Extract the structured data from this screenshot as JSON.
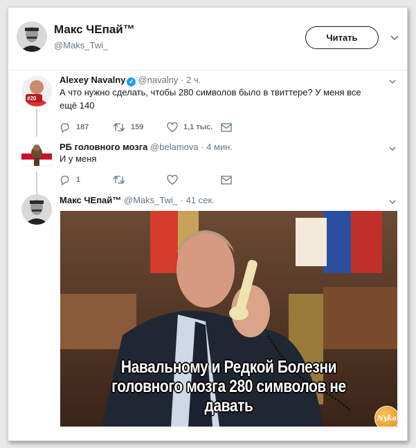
{
  "header": {
    "display_name": "Макс ЧЕпай™",
    "handle": "@Maks_Twi_",
    "follow_label": "Читать"
  },
  "tweets": [
    {
      "name": "Alexey Navalny",
      "verified": true,
      "handle": "@navalny",
      "time": "· 2 ч.",
      "text": "А что нужно сделать, чтобы 280 символов было в твиттере? У меня все ещё 140",
      "replies": "187",
      "retweets": "159",
      "likes": "1,1 тыс.",
      "avatar_badge": "#20"
    },
    {
      "name": "РБ головного мозга",
      "handle": "@belamova",
      "time": "· 4 мин.",
      "text": "И у меня",
      "replies": "1",
      "retweets": "",
      "likes": ""
    },
    {
      "name": "Макс ЧЕпай™",
      "handle": "@Maks_Twi_",
      "time": "· 41 сек.",
      "image_caption": [
        "Навальному и Редкой Болезни",
        "головного мозга 280 символов не",
        "давать"
      ],
      "watermark": "Nyka"
    }
  ],
  "colors": {
    "accent_blue": "#1da1f2",
    "text_secondary": "#657786",
    "thread_line": "#ccd6dd"
  },
  "icons": [
    "chevron-down-icon",
    "reply-icon",
    "retweet-icon",
    "like-icon",
    "message-icon",
    "verified-icon"
  ]
}
